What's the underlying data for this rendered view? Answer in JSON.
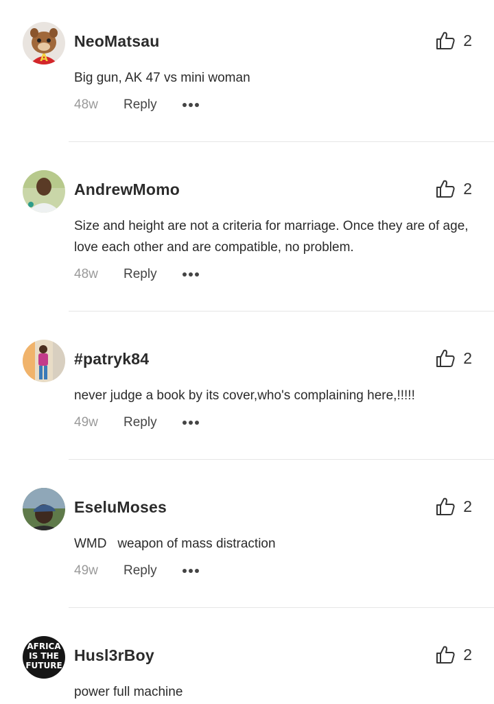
{
  "comments": [
    {
      "username": "NeoMatsau",
      "text": "Big gun, AK 47 vs mini woman",
      "time": "48w",
      "reply": "Reply",
      "likes": "2",
      "avatar": "chipmunk-avatar"
    },
    {
      "username": "AndrewMomo",
      "text": "Size and height are not a criteria for marriage. Once they are of age, love each other and are compatible, no problem.",
      "time": "48w",
      "reply": "Reply",
      "likes": "2",
      "avatar": "man-photo-avatar"
    },
    {
      "username": "#patryk84",
      "text": "never judge a book by its cover,who's complaining here,!!!!!",
      "time": "49w",
      "reply": "Reply",
      "likes": "2",
      "avatar": "person-photo-avatar"
    },
    {
      "username": "EseluMoses",
      "text": "WMD   weapon of mass distraction",
      "time": "49w",
      "reply": "Reply",
      "likes": "2",
      "avatar": "man-cap-avatar"
    },
    {
      "username": "Husl3rBoy",
      "text": "power full machine",
      "time": "",
      "reply": "",
      "likes": "2",
      "avatar": "africa-future-avatar"
    }
  ],
  "avatar_badge": {
    "letter": "A"
  },
  "africa_avatar": {
    "lines": [
      "AFRICA",
      "IS THE",
      "FUTURE"
    ]
  }
}
